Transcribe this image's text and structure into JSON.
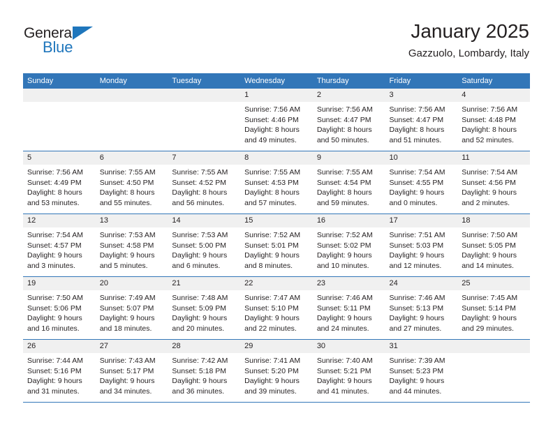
{
  "brand": {
    "name_top": "General",
    "name_bottom": "Blue",
    "triangle_icon": "triangle-icon",
    "color_blue": "#1f76bc",
    "color_dark": "#231f20"
  },
  "header": {
    "month_title": "January 2025",
    "location": "Gazzuolo, Lombardy, Italy"
  },
  "theme": {
    "header_bg": "#3276b8",
    "header_text": "#ffffff",
    "daynum_bg": "#f0f0f0",
    "cell_bg": "#ffffff",
    "row_divider": "#3276b8"
  },
  "calendar": {
    "weekday_headers": [
      "Sunday",
      "Monday",
      "Tuesday",
      "Wednesday",
      "Thursday",
      "Friday",
      "Saturday"
    ],
    "weeks": [
      [
        {
          "day": "",
          "sunrise": "",
          "sunset": "",
          "daylight_1": "",
          "daylight_2": ""
        },
        {
          "day": "",
          "sunrise": "",
          "sunset": "",
          "daylight_1": "",
          "daylight_2": ""
        },
        {
          "day": "",
          "sunrise": "",
          "sunset": "",
          "daylight_1": "",
          "daylight_2": ""
        },
        {
          "day": "1",
          "sunrise": "Sunrise: 7:56 AM",
          "sunset": "Sunset: 4:46 PM",
          "daylight_1": "Daylight: 8 hours",
          "daylight_2": "and 49 minutes."
        },
        {
          "day": "2",
          "sunrise": "Sunrise: 7:56 AM",
          "sunset": "Sunset: 4:47 PM",
          "daylight_1": "Daylight: 8 hours",
          "daylight_2": "and 50 minutes."
        },
        {
          "day": "3",
          "sunrise": "Sunrise: 7:56 AM",
          "sunset": "Sunset: 4:47 PM",
          "daylight_1": "Daylight: 8 hours",
          "daylight_2": "and 51 minutes."
        },
        {
          "day": "4",
          "sunrise": "Sunrise: 7:56 AM",
          "sunset": "Sunset: 4:48 PM",
          "daylight_1": "Daylight: 8 hours",
          "daylight_2": "and 52 minutes."
        }
      ],
      [
        {
          "day": "5",
          "sunrise": "Sunrise: 7:56 AM",
          "sunset": "Sunset: 4:49 PM",
          "daylight_1": "Daylight: 8 hours",
          "daylight_2": "and 53 minutes."
        },
        {
          "day": "6",
          "sunrise": "Sunrise: 7:55 AM",
          "sunset": "Sunset: 4:50 PM",
          "daylight_1": "Daylight: 8 hours",
          "daylight_2": "and 55 minutes."
        },
        {
          "day": "7",
          "sunrise": "Sunrise: 7:55 AM",
          "sunset": "Sunset: 4:52 PM",
          "daylight_1": "Daylight: 8 hours",
          "daylight_2": "and 56 minutes."
        },
        {
          "day": "8",
          "sunrise": "Sunrise: 7:55 AM",
          "sunset": "Sunset: 4:53 PM",
          "daylight_1": "Daylight: 8 hours",
          "daylight_2": "and 57 minutes."
        },
        {
          "day": "9",
          "sunrise": "Sunrise: 7:55 AM",
          "sunset": "Sunset: 4:54 PM",
          "daylight_1": "Daylight: 8 hours",
          "daylight_2": "and 59 minutes."
        },
        {
          "day": "10",
          "sunrise": "Sunrise: 7:54 AM",
          "sunset": "Sunset: 4:55 PM",
          "daylight_1": "Daylight: 9 hours",
          "daylight_2": "and 0 minutes."
        },
        {
          "day": "11",
          "sunrise": "Sunrise: 7:54 AM",
          "sunset": "Sunset: 4:56 PM",
          "daylight_1": "Daylight: 9 hours",
          "daylight_2": "and 2 minutes."
        }
      ],
      [
        {
          "day": "12",
          "sunrise": "Sunrise: 7:54 AM",
          "sunset": "Sunset: 4:57 PM",
          "daylight_1": "Daylight: 9 hours",
          "daylight_2": "and 3 minutes."
        },
        {
          "day": "13",
          "sunrise": "Sunrise: 7:53 AM",
          "sunset": "Sunset: 4:58 PM",
          "daylight_1": "Daylight: 9 hours",
          "daylight_2": "and 5 minutes."
        },
        {
          "day": "14",
          "sunrise": "Sunrise: 7:53 AM",
          "sunset": "Sunset: 5:00 PM",
          "daylight_1": "Daylight: 9 hours",
          "daylight_2": "and 6 minutes."
        },
        {
          "day": "15",
          "sunrise": "Sunrise: 7:52 AM",
          "sunset": "Sunset: 5:01 PM",
          "daylight_1": "Daylight: 9 hours",
          "daylight_2": "and 8 minutes."
        },
        {
          "day": "16",
          "sunrise": "Sunrise: 7:52 AM",
          "sunset": "Sunset: 5:02 PM",
          "daylight_1": "Daylight: 9 hours",
          "daylight_2": "and 10 minutes."
        },
        {
          "day": "17",
          "sunrise": "Sunrise: 7:51 AM",
          "sunset": "Sunset: 5:03 PM",
          "daylight_1": "Daylight: 9 hours",
          "daylight_2": "and 12 minutes."
        },
        {
          "day": "18",
          "sunrise": "Sunrise: 7:50 AM",
          "sunset": "Sunset: 5:05 PM",
          "daylight_1": "Daylight: 9 hours",
          "daylight_2": "and 14 minutes."
        }
      ],
      [
        {
          "day": "19",
          "sunrise": "Sunrise: 7:50 AM",
          "sunset": "Sunset: 5:06 PM",
          "daylight_1": "Daylight: 9 hours",
          "daylight_2": "and 16 minutes."
        },
        {
          "day": "20",
          "sunrise": "Sunrise: 7:49 AM",
          "sunset": "Sunset: 5:07 PM",
          "daylight_1": "Daylight: 9 hours",
          "daylight_2": "and 18 minutes."
        },
        {
          "day": "21",
          "sunrise": "Sunrise: 7:48 AM",
          "sunset": "Sunset: 5:09 PM",
          "daylight_1": "Daylight: 9 hours",
          "daylight_2": "and 20 minutes."
        },
        {
          "day": "22",
          "sunrise": "Sunrise: 7:47 AM",
          "sunset": "Sunset: 5:10 PM",
          "daylight_1": "Daylight: 9 hours",
          "daylight_2": "and 22 minutes."
        },
        {
          "day": "23",
          "sunrise": "Sunrise: 7:46 AM",
          "sunset": "Sunset: 5:11 PM",
          "daylight_1": "Daylight: 9 hours",
          "daylight_2": "and 24 minutes."
        },
        {
          "day": "24",
          "sunrise": "Sunrise: 7:46 AM",
          "sunset": "Sunset: 5:13 PM",
          "daylight_1": "Daylight: 9 hours",
          "daylight_2": "and 27 minutes."
        },
        {
          "day": "25",
          "sunrise": "Sunrise: 7:45 AM",
          "sunset": "Sunset: 5:14 PM",
          "daylight_1": "Daylight: 9 hours",
          "daylight_2": "and 29 minutes."
        }
      ],
      [
        {
          "day": "26",
          "sunrise": "Sunrise: 7:44 AM",
          "sunset": "Sunset: 5:16 PM",
          "daylight_1": "Daylight: 9 hours",
          "daylight_2": "and 31 minutes."
        },
        {
          "day": "27",
          "sunrise": "Sunrise: 7:43 AM",
          "sunset": "Sunset: 5:17 PM",
          "daylight_1": "Daylight: 9 hours",
          "daylight_2": "and 34 minutes."
        },
        {
          "day": "28",
          "sunrise": "Sunrise: 7:42 AM",
          "sunset": "Sunset: 5:18 PM",
          "daylight_1": "Daylight: 9 hours",
          "daylight_2": "and 36 minutes."
        },
        {
          "day": "29",
          "sunrise": "Sunrise: 7:41 AM",
          "sunset": "Sunset: 5:20 PM",
          "daylight_1": "Daylight: 9 hours",
          "daylight_2": "and 39 minutes."
        },
        {
          "day": "30",
          "sunrise": "Sunrise: 7:40 AM",
          "sunset": "Sunset: 5:21 PM",
          "daylight_1": "Daylight: 9 hours",
          "daylight_2": "and 41 minutes."
        },
        {
          "day": "31",
          "sunrise": "Sunrise: 7:39 AM",
          "sunset": "Sunset: 5:23 PM",
          "daylight_1": "Daylight: 9 hours",
          "daylight_2": "and 44 minutes."
        },
        {
          "day": "",
          "sunrise": "",
          "sunset": "",
          "daylight_1": "",
          "daylight_2": ""
        }
      ]
    ]
  }
}
